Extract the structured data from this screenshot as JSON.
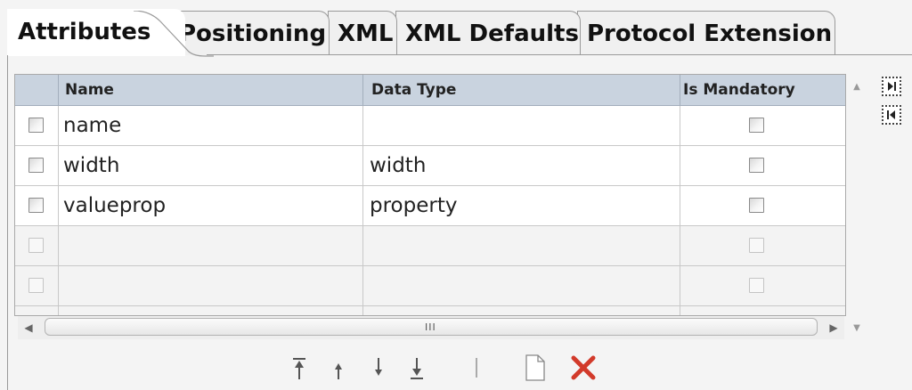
{
  "tabs": [
    {
      "label": "Attributes",
      "active": true
    },
    {
      "label": "Positioning",
      "active": false
    },
    {
      "label": "XML",
      "active": false
    },
    {
      "label": "XML Defaults",
      "active": false
    },
    {
      "label": "Protocol Extension",
      "active": false
    }
  ],
  "table": {
    "columns": [
      "Name",
      "Data Type",
      "Is Mandatory"
    ],
    "rows": [
      {
        "name": "name",
        "data_type": "",
        "mandatory": false
      },
      {
        "name": "width",
        "data_type": "width",
        "mandatory": false
      },
      {
        "name": "valueprop",
        "data_type": "property",
        "mandatory": false
      },
      {
        "name": "",
        "data_type": "",
        "mandatory": false
      },
      {
        "name": "",
        "data_type": "",
        "mandatory": false
      }
    ]
  },
  "scrollbar": {
    "grip": "III"
  },
  "icons": {
    "move_top": "move-to-top-icon",
    "move_up": "move-up-icon",
    "move_down": "move-down-icon",
    "move_bottom": "move-to-bottom-icon",
    "new": "new-document-icon",
    "delete": "delete-x-icon",
    "expand": "expand-panel-icon",
    "collapse": "collapse-panel-icon"
  },
  "colors": {
    "header_bg": "#c9d3df",
    "delete_red": "#d23a2a"
  }
}
